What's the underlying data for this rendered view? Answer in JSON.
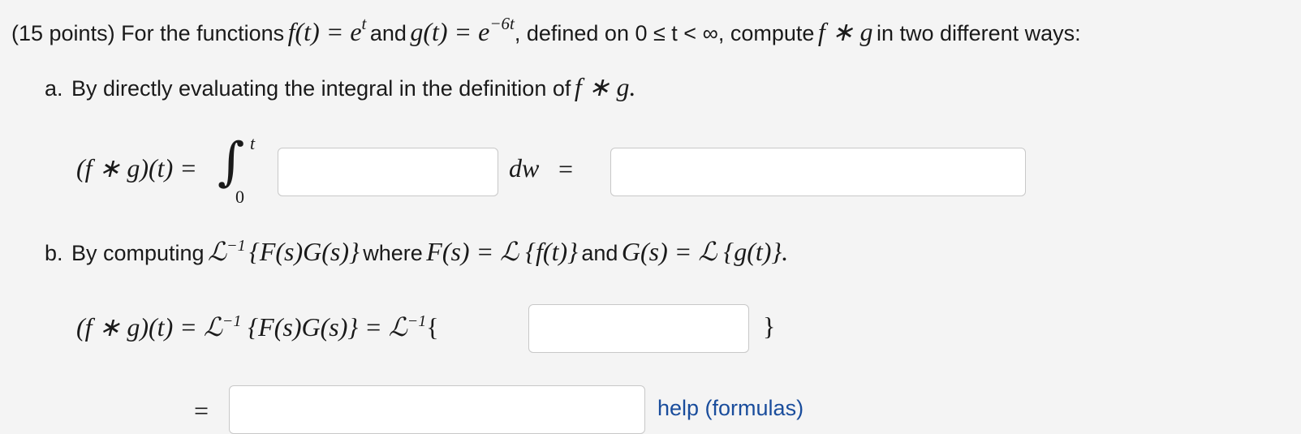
{
  "problem": {
    "points_prefix": "(15 points) For the functions",
    "f_def": "f(t) = e",
    "f_exp": "t",
    "and_word": "and",
    "g_def": "g(t) = e",
    "g_exp": "−6t",
    "domain_text": ", defined on 0 ≤ t < ∞, compute",
    "conv": "f ∗ g",
    "tail": "in two different ways:"
  },
  "part_a": {
    "label": "a.",
    "text": "By directly evaluating the integral in the definition of",
    "conv": "f ∗ g.",
    "lhs": "(f ∗ g)(t) =",
    "integral_sign": "∫",
    "upper_limit": "t",
    "lower_limit": "0",
    "dw": "dw",
    "equals": "="
  },
  "part_b": {
    "label": "b.",
    "text_prefix": "By computing",
    "laplace_inv": "ℒ",
    "inv_exp": "−1",
    "brace_expr": "{F(s)G(s)}",
    "where_word": "where",
    "F_def": "F(s) = ℒ {f(t)}",
    "and_word": "and",
    "G_def": "G(s) = ℒ {g(t)}.",
    "line2_lhs": "(f ∗ g)(t) = ℒ",
    "line2_mid": "{F(s)G(s)} = ℒ",
    "open_brace": "{",
    "close_brace": "}",
    "equals": "="
  },
  "help_link": "help (formulas)"
}
